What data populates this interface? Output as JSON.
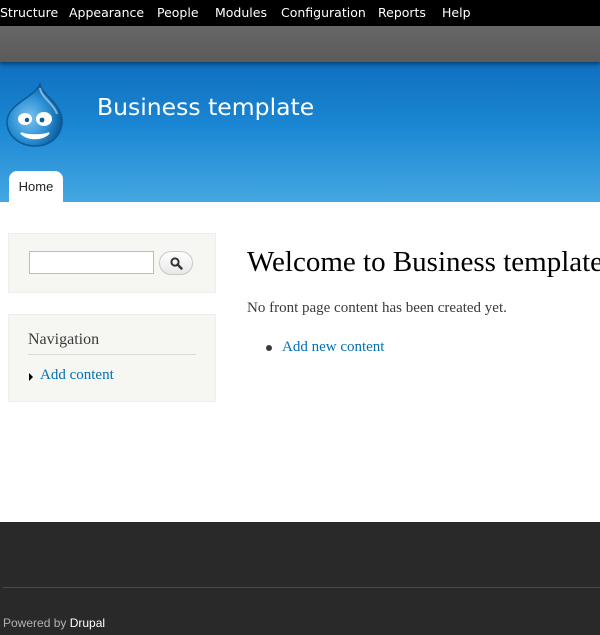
{
  "admin_menu": {
    "items": [
      {
        "label": "Structure"
      },
      {
        "label": "Appearance"
      },
      {
        "label": "People"
      },
      {
        "label": "Modules"
      },
      {
        "label": "Configuration"
      },
      {
        "label": "Reports"
      },
      {
        "label": "Help"
      }
    ]
  },
  "header": {
    "logo_icon": "drupal-drop-icon",
    "site_name": "Business template",
    "tabs": [
      {
        "label": "Home",
        "active": true
      }
    ]
  },
  "sidebar": {
    "search": {
      "value": "",
      "button_icon": "magnifier-icon"
    },
    "navigation": {
      "title": "Navigation",
      "links": [
        {
          "label": "Add content"
        }
      ]
    }
  },
  "main": {
    "title": "Welcome to Business template",
    "intro": "No front page content has been created yet.",
    "links": [
      {
        "label": "Add new content"
      }
    ]
  },
  "footer": {
    "powered_prefix": "Powered by",
    "powered_link": "Drupal"
  },
  "colors": {
    "header_blue": "#1a86d3",
    "link": "#0071b3",
    "footer": "#292929",
    "toolbar": "#000000"
  }
}
